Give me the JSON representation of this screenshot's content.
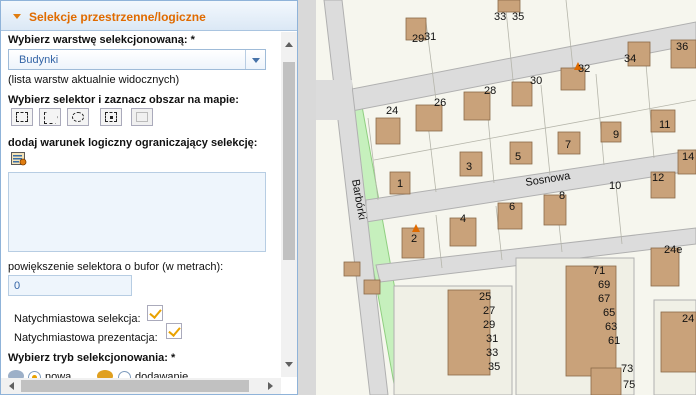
{
  "panel": {
    "title": "Selekcje przestrzenne/logiczne",
    "layer_label": "Wybierz warstwę selekcjonowaną: *",
    "layer_value": "Budynki",
    "layer_note": "(lista warstw aktualnie widocznych)",
    "selector_label": "Wybierz selektor i zaznacz obszar na mapie:",
    "selector_icons": [
      "rectangle-select-icon",
      "polygon-select-icon",
      "circle-select-icon",
      "point-select-icon",
      "disabled-select-icon"
    ],
    "condition_label": "dodaj warunek logiczny ograniczający selekcję:",
    "condition_value": "",
    "buffer_label": "powiększenie selektora o bufor (w metrach):",
    "buffer_value": "0",
    "instant_selection_label": "Natychmiastowa selekcja:",
    "instant_selection_checked": true,
    "instant_presentation_label": "Natychmiastowa prezentacja:",
    "instant_presentation_checked": true,
    "mode_label": "Wybierz tryb selekcjonowania: *",
    "mode_options": [
      "nowa",
      "dodawanie"
    ],
    "mode_selected": "nowa"
  },
  "map": {
    "streets": [
      "Sosnowa",
      "Barbórki"
    ],
    "buildings": [
      "29",
      "31",
      "33",
      "35",
      "34",
      "36",
      "32",
      "30",
      "28",
      "26",
      "24",
      "9",
      "7",
      "5",
      "3",
      "1",
      "11",
      "12",
      "10",
      "8",
      "6",
      "4",
      "2",
      "14",
      "24e",
      "71",
      "69",
      "67",
      "65",
      "63",
      "61",
      "25",
      "27",
      "29",
      "31",
      "33",
      "35",
      "73",
      "75",
      "24"
    ]
  },
  "colors": {
    "accent": "#e06b00",
    "building": "#c9a27a",
    "road": "#cfcfcf",
    "green_strip": "#c6f0bd"
  }
}
